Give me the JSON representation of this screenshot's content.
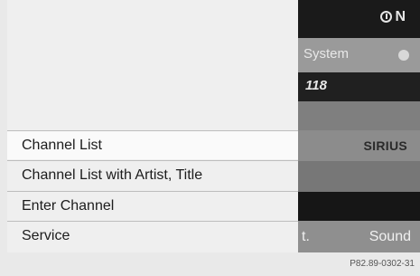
{
  "status": {
    "on_label": "N",
    "system_label": "System",
    "channel_number": "118",
    "sirius_label": "SIRIUS"
  },
  "menu": {
    "items": [
      {
        "label": "Channel List",
        "selected": true
      },
      {
        "label": "Channel List with Artist, Title"
      },
      {
        "label": "Enter Channel"
      },
      {
        "label": "Service"
      }
    ]
  },
  "bottom_bar": {
    "left_fragment": "t.",
    "sound_label": "Sound"
  },
  "caption": "P82.89-0302-31"
}
